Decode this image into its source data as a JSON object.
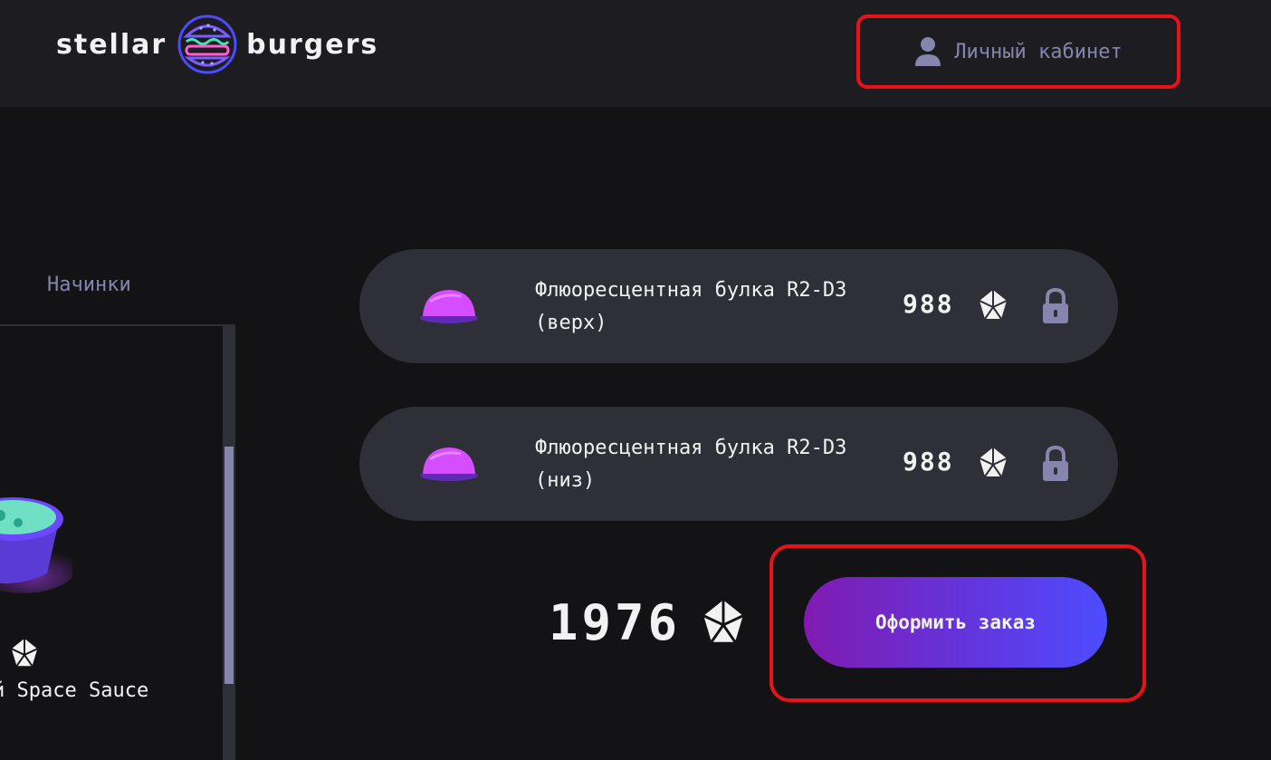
{
  "header": {
    "logo_left": "stellar",
    "logo_right": "burgers",
    "account_label": "Личный кабинет"
  },
  "ingredients_panel": {
    "tab_fillings": "Начинки",
    "visible_item_name": "й Space Sauce"
  },
  "constructor": {
    "items": [
      {
        "name": "Флюоресцентная булка R2-D3 (верх)",
        "price": "988"
      },
      {
        "name": "Флюоресцентная булка R2-D3 (низ)",
        "price": "988"
      }
    ],
    "total": "1976",
    "order_button": "Оформить заказ"
  },
  "colors": {
    "background": "#131316",
    "header_bg": "#1c1c21",
    "item_bg": "#2f2f37",
    "muted_text": "#8585ad",
    "highlight": "#e8121b",
    "button_gradient_start": "#801ab2",
    "button_gradient_end": "#4c4cff"
  },
  "icons": {
    "currency": "currency-crystal-icon",
    "lock": "lock-icon",
    "profile": "profile-icon"
  }
}
